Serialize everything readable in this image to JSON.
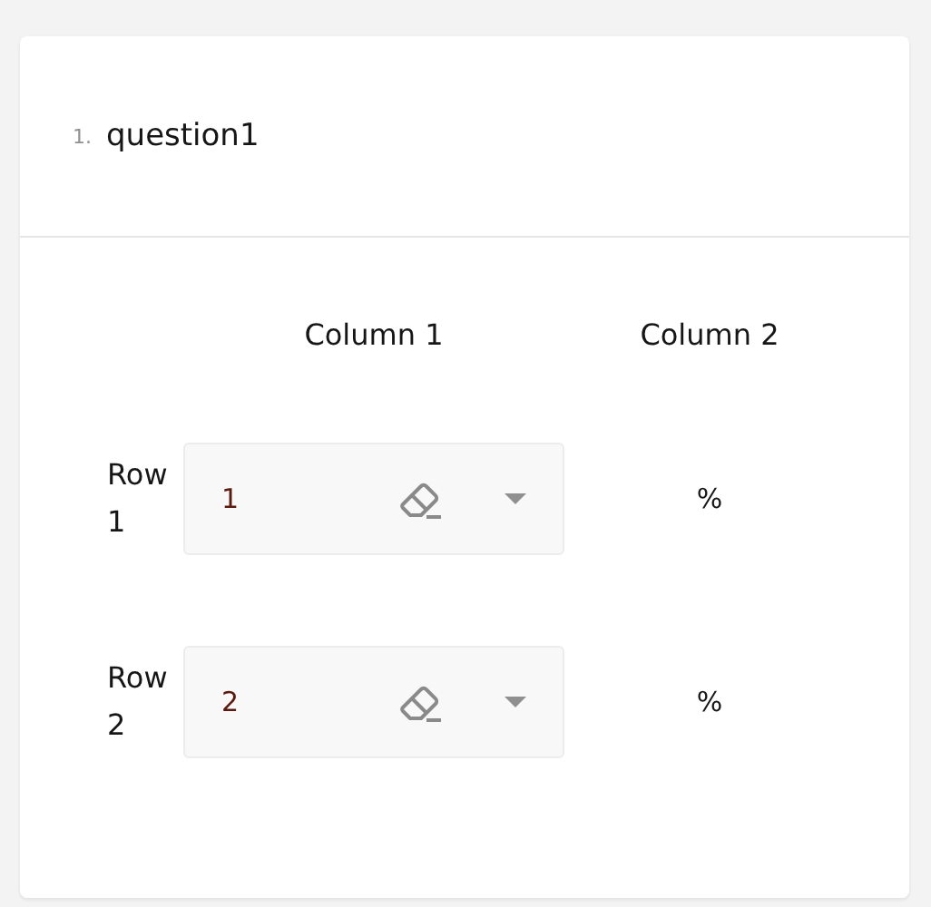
{
  "question": {
    "number": "1.",
    "title": "question1"
  },
  "columns": [
    "Column 1",
    "Column 2"
  ],
  "rows": [
    {
      "label": "Row 1",
      "value": "1",
      "cell_2": "%"
    },
    {
      "label": "Row 2",
      "value": "2",
      "cell_2": "%"
    }
  ]
}
